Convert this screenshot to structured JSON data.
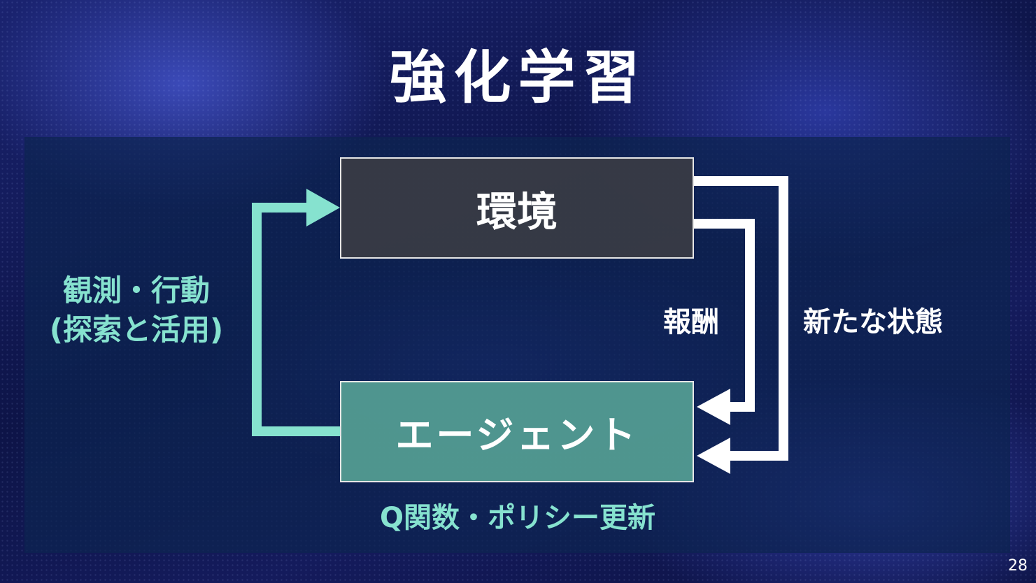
{
  "slide": {
    "title": "強化学習",
    "page_number": "28"
  },
  "diagram": {
    "environment": "環境",
    "agent": "エージェント",
    "left_label": "観測・行動\n(探索と活用)",
    "reward_label": "報酬",
    "state_label": "新たな状態",
    "update_label": "Q関数・ポリシー更新"
  },
  "colors": {
    "accent_teal": "#86e2cf",
    "arrow_white": "#ffffff",
    "env_box": "#3a3c44",
    "agent_box": "#55a094"
  }
}
